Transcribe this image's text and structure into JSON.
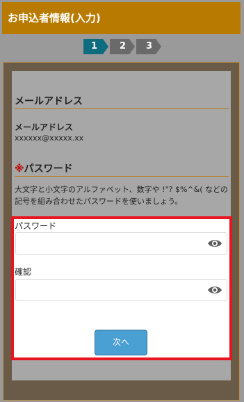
{
  "header": {
    "title": "お申込者情報(入力)"
  },
  "steps": [
    "1",
    "2",
    "3"
  ],
  "email_section": {
    "title": "メールアドレス",
    "field_label": "メールアドレス",
    "value": "xxxxxx@xxxxx.xx"
  },
  "password_section": {
    "required_mark": "※",
    "title": "パスワード",
    "description": "大文字と小文字のアルファベット、数字や !\"? $%^&( などの記号を組み合わせたパスワードを使いましょう。"
  },
  "fields": {
    "password_label": "パスワード",
    "confirm_label": "確認"
  },
  "buttons": {
    "next": "次へ"
  },
  "icons": {
    "password_toggle": "eye-icon",
    "confirm_toggle": "eye-icon"
  },
  "colors": {
    "header": "#b97a00",
    "active_step": "#0e6c7f",
    "highlight_border": "#e8141f",
    "next_button": "#4a9fd3"
  }
}
